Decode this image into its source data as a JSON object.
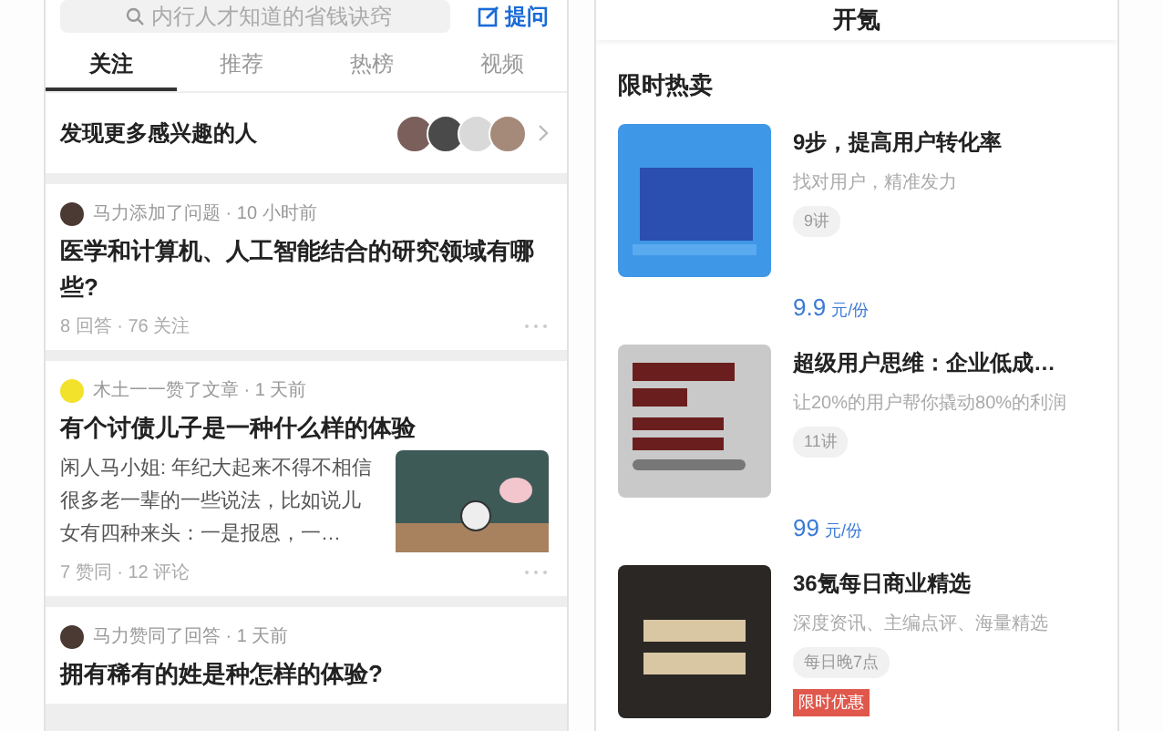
{
  "feed_screen": {
    "search": {
      "placeholder": "内行人才知道的省钱诀窍"
    },
    "ask_button": {
      "label": "提问"
    },
    "tabs": [
      {
        "label": "关注",
        "selected": true
      },
      {
        "label": "推荐",
        "selected": false
      },
      {
        "label": "热榜",
        "selected": false
      },
      {
        "label": "视频",
        "selected": false
      }
    ],
    "discover": {
      "label": "发现更多感兴趣的人"
    },
    "cards": [
      {
        "kind": "question",
        "meta": "马力添加了问题 · 10 小时前",
        "title": "医学和计算机、人工智能结合的研究领域有哪些?",
        "stats": "8 回答 · 76 关注"
      },
      {
        "kind": "article",
        "meta": "木土一一赞了文章 · 1 天前",
        "title": "有个讨债儿子是一种什么样的体验",
        "excerpt": "闲人马小姐: 年纪大起来不得不相信很多老一辈的一些说法，比如说儿女有四种来头：一是报恩，一…",
        "stats": "7 赞同 · 12 评论"
      },
      {
        "kind": "question",
        "meta": "马力赞同了回答 · 1 天前",
        "title": "拥有稀有的姓是种怎样的体验?"
      }
    ]
  },
  "shop_screen": {
    "title": "开氪",
    "section_title": "限时热卖",
    "products": [
      {
        "kind": "blue",
        "title": "9步，提高用户转化率",
        "subtitle": "找对用户，精准发力",
        "tag": "9讲",
        "price": "9.9",
        "unit": "元/份"
      },
      {
        "kind": "grey",
        "title": "超级用户思维：企业低成…",
        "subtitle": "让20%的用户帮你撬动80%的利润",
        "tag": "11讲",
        "price": "99",
        "unit": "元/份"
      },
      {
        "kind": "dark",
        "title": "36氪每日商业精选",
        "subtitle": "深度资讯、主编点评、海量精选",
        "tag": "每日晚7点",
        "badge": "限时优惠"
      }
    ]
  }
}
